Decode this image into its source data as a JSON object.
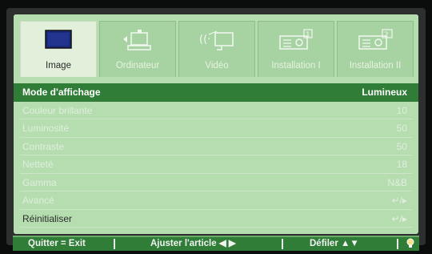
{
  "tabs": [
    {
      "label": "Image",
      "icon": "monitor-icon",
      "active": true
    },
    {
      "label": "Ordinateur",
      "icon": "computer-icon",
      "active": false
    },
    {
      "label": "Vidéo",
      "icon": "video-source-icon",
      "active": false
    },
    {
      "label": "Installation I",
      "icon": "projector-icon",
      "active": false
    },
    {
      "label": "Installation II",
      "icon": "projector-settings-icon",
      "active": false
    }
  ],
  "menu": {
    "items": [
      {
        "label": "Mode d'affichage",
        "value": "Lumineux",
        "state": "selected"
      },
      {
        "label": "Couleur brillante",
        "value": "10",
        "state": "disabled"
      },
      {
        "label": "Luminosité",
        "value": "50",
        "state": "disabled"
      },
      {
        "label": "Contraste",
        "value": "50",
        "state": "disabled"
      },
      {
        "label": "Netteté",
        "value": "18",
        "state": "disabled"
      },
      {
        "label": "Gamma",
        "value": "N&B",
        "state": "disabled"
      },
      {
        "label": "Avancé",
        "value": "↵/▸",
        "state": "disabled"
      },
      {
        "label": "Réinitialiser",
        "value": "↵/▸",
        "state": "enabled"
      }
    ]
  },
  "footer": {
    "exit": "Quitter = Exit",
    "adjust": "Ajuster l'article ◀ ▶",
    "scroll": "Défiler ▲▼",
    "icon": "lamp-icon"
  },
  "colors": {
    "panel": "#b6ddb0",
    "highlight": "#2f7d36",
    "active_tab": "#e2efdb"
  }
}
